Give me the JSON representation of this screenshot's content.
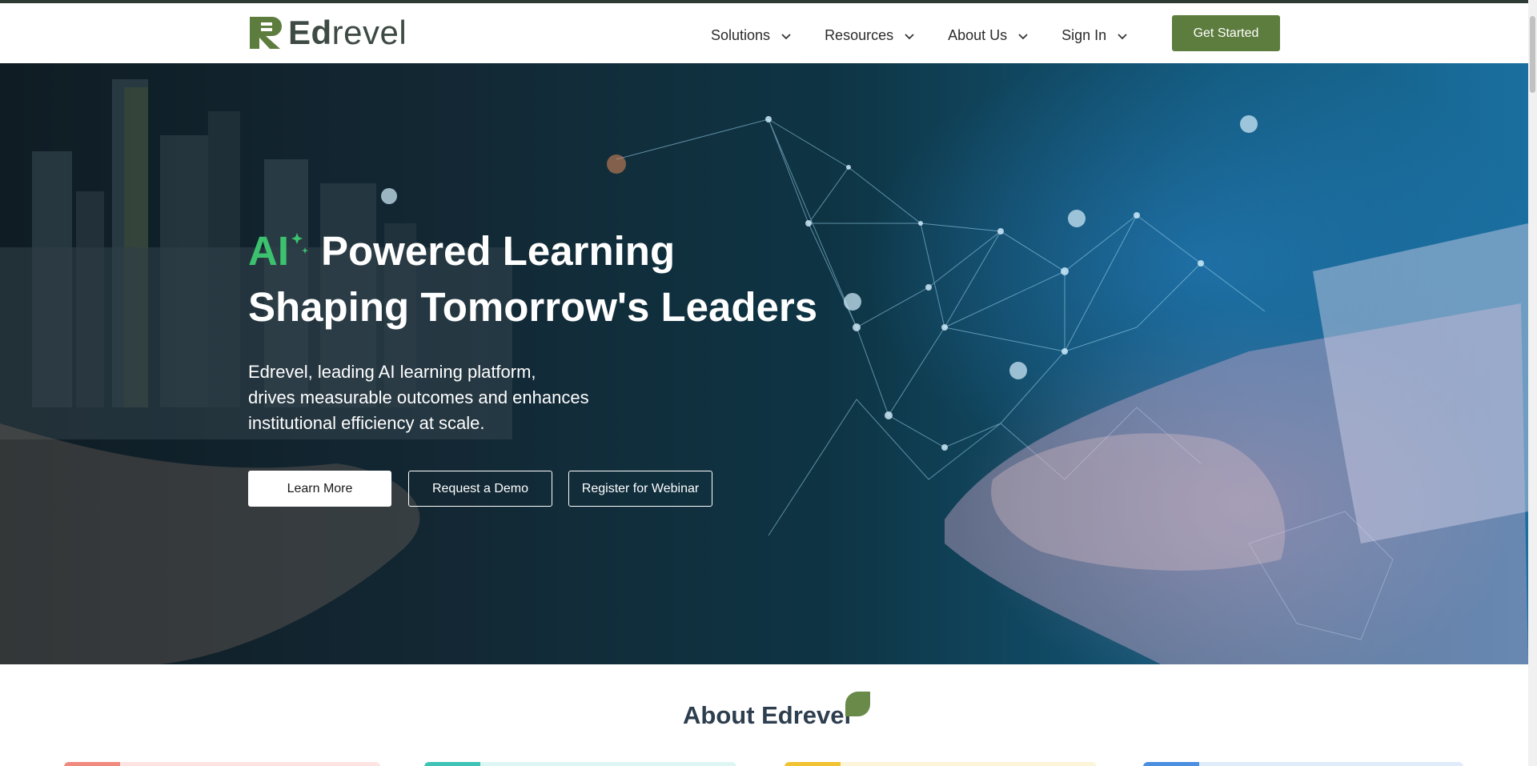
{
  "brand": {
    "logo_strong": "Ed",
    "logo_rest": "revel",
    "accent_color": "#5d7d3e",
    "ai_color": "#3cc26e"
  },
  "nav": {
    "items": [
      {
        "label": "Solutions",
        "icon": "chevron-down-icon"
      },
      {
        "label": "Resources",
        "icon": "chevron-down-icon"
      },
      {
        "label": "About Us",
        "icon": "chevron-down-icon"
      },
      {
        "label": "Sign In",
        "icon": "chevron-down-icon"
      }
    ],
    "cta_label": "Get Started"
  },
  "hero": {
    "ai_label": "AI",
    "title_line1_rest": "Powered Learning",
    "title_line2": "Shaping Tomorrow's Leaders",
    "subtitle_lines": [
      "Edrevel, leading AI learning platform,",
      "drives measurable outcomes and enhances",
      "institutional efficiency at scale."
    ],
    "buttons": {
      "learn_more": "Learn More",
      "request_demo": "Request a Demo",
      "register_webinar": "Register for Webinar"
    }
  },
  "about": {
    "title": "About Edrevel",
    "card_colors": [
      "#f08a7e",
      "#3fc3b7",
      "#f1c232",
      "#4a8fe0"
    ]
  }
}
